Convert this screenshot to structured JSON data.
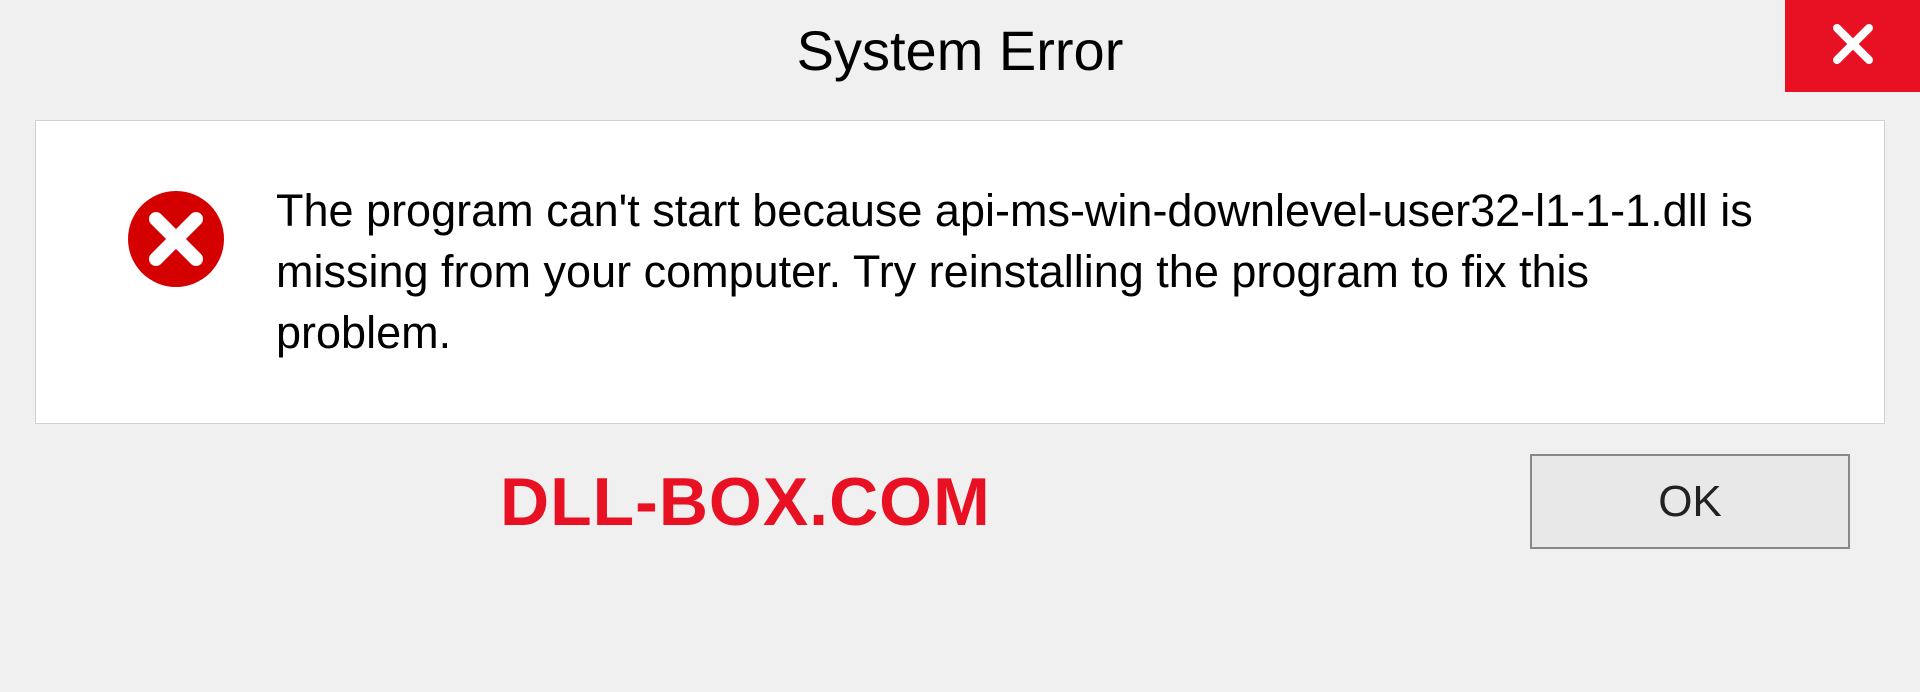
{
  "window": {
    "title": "System Error"
  },
  "dialog": {
    "message": "The program can't start because api-ms-win-downlevel-user32-l1-1-1.dll is missing from your computer. Try reinstalling the program to fix this problem."
  },
  "footer": {
    "watermark": "DLL-BOX.COM",
    "ok_label": "OK"
  },
  "colors": {
    "close_bg": "#e81123",
    "error_red": "#d40000",
    "watermark_red": "#e81123"
  }
}
